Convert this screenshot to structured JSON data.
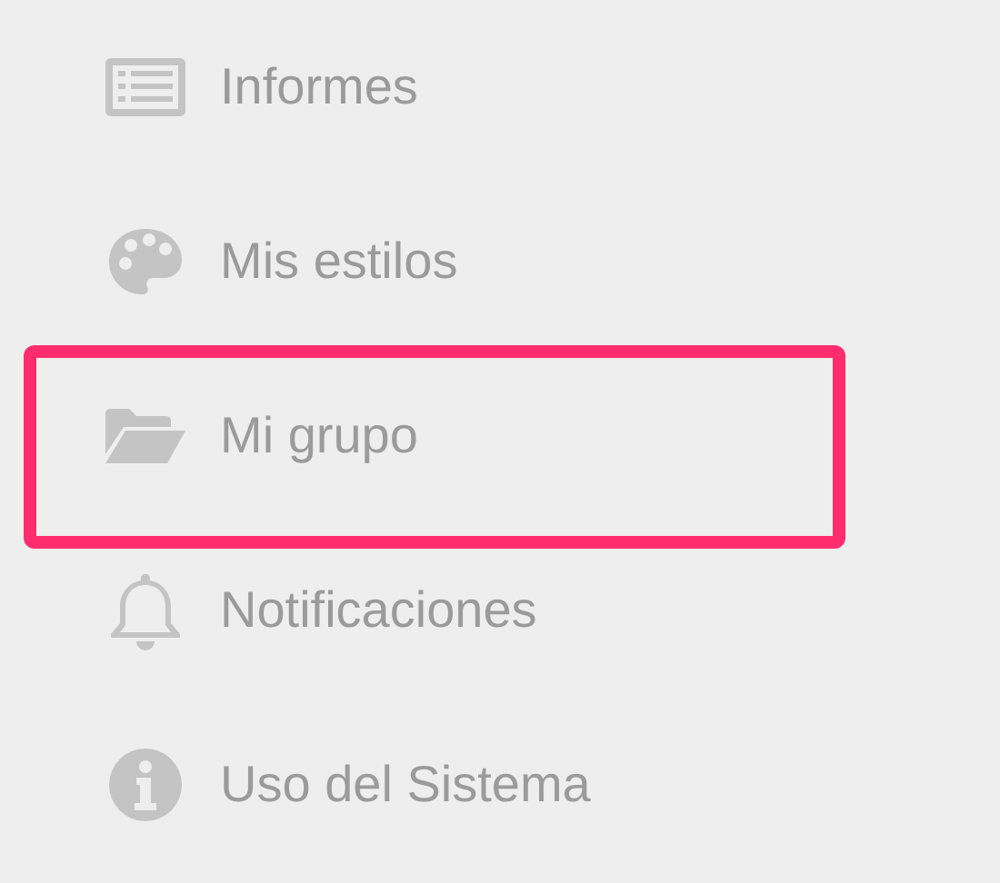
{
  "menu": {
    "items": [
      {
        "label": "Informes",
        "highlighted": false
      },
      {
        "label": "Mis estilos",
        "highlighted": false
      },
      {
        "label": "Mi grupo",
        "highlighted": true
      },
      {
        "label": "Notificaciones",
        "highlighted": false
      },
      {
        "label": "Uso del Sistema",
        "highlighted": false
      }
    ]
  }
}
